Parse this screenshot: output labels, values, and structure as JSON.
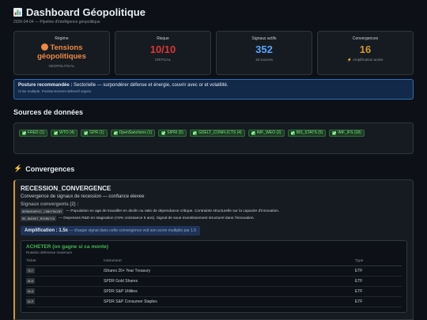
{
  "header": {
    "title": "Dashboard Géopolitique",
    "subtitle": "2026-04-04 — Pipeline d'intelligence géopolitique"
  },
  "kpis": {
    "regime": {
      "label": "Régime",
      "value_line1": "Tensions",
      "value_line2": "géopolitiques",
      "sub": "GEOPOLITICAL",
      "color": "#f0883e"
    },
    "risk": {
      "label": "Risque",
      "value": "10/10",
      "sub": "CRITICAL",
      "color": "#da3633"
    },
    "signals": {
      "label": "Signaux actifs",
      "value": "352",
      "sub": "18 sources",
      "color": "#58a6ff"
    },
    "convergences": {
      "label": "Convergences",
      "value": "16",
      "sub": "Amplification active",
      "color": "#d29922"
    }
  },
  "posture": {
    "label": "Posture recommandée :",
    "text": "Sectorielle — surpondérer défense et énergie, couvrir avec or et volatilité.",
    "sub": "Crise multiple. Positionnement defensif urgent."
  },
  "sources": {
    "title": "Sources de données",
    "items": [
      "FRED (1)",
      "WTO (4)",
      "GPR (1)",
      "OpenSanctions (1)",
      "SIPRI (5)",
      "GDELT_CONFLICTS (4)",
      "IMF_WEO (2)",
      "BIS_STATS (5)",
      "IMF_IFS (18)"
    ]
  },
  "convergences": {
    "title": "Convergences",
    "card": {
      "name": "RECESSION_CONVERGENCE",
      "description": "Convergence de signaux de recession — confiance elevee",
      "signals_label": "Signaux convergents (2) :",
      "signals": [
        {
          "tag": "DEMOGRAPHIC_CONSTRAINT",
          "text": "— Population en age de travailler en declin ou ratio de dependance critique. Contrainte structurelle sur la capacite d'innovation."
        },
        {
          "tag": "RD_BUDGET_MISMATCH",
          "text": "— Depenses R&D en stagnation (<5% croissance 5 ans). Signal de sous-investissement structurel dans l'innovation."
        }
      ],
      "amplification_label": "Amplification : 1.5x",
      "amplification_text": "— chaque signal dans cette convergence voit son score multiplie par 1.5",
      "buy": {
        "title": "ACHETER (on gagne si ca monte)",
        "subtitle": "Rotation defensive maximum",
        "columns": [
          "Ticker",
          "Instrument",
          "Type"
        ],
        "rows": [
          {
            "ticker": "TLT",
            "instrument": "iShares 20+ Year Treasury",
            "type": "ETF"
          },
          {
            "ticker": "GLD",
            "instrument": "SPDR Gold Shares",
            "type": "ETF"
          },
          {
            "ticker": "XLU",
            "instrument": "SPDR S&P Utilities",
            "type": "ETF"
          },
          {
            "ticker": "XLP",
            "instrument": "SPDR S&P Consumer Staples",
            "type": "ETF"
          }
        ]
      }
    }
  }
}
